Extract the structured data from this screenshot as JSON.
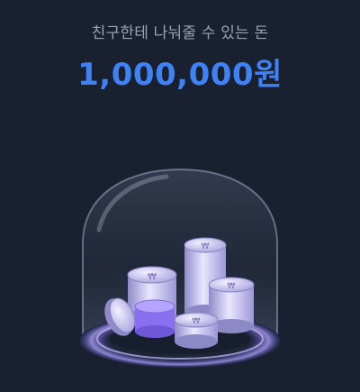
{
  "header": {
    "subtitle": "친구한테 나눠줄 수 있는 돈",
    "amount": "1,000,000원"
  },
  "illustration": {
    "icon": "coins-under-glass-dome",
    "coin_symbol": "₩"
  },
  "colors": {
    "background": "#192130",
    "subtitle": "#9aa3b2",
    "amount": "#3f82f4",
    "coin": "#c9c6ee"
  }
}
